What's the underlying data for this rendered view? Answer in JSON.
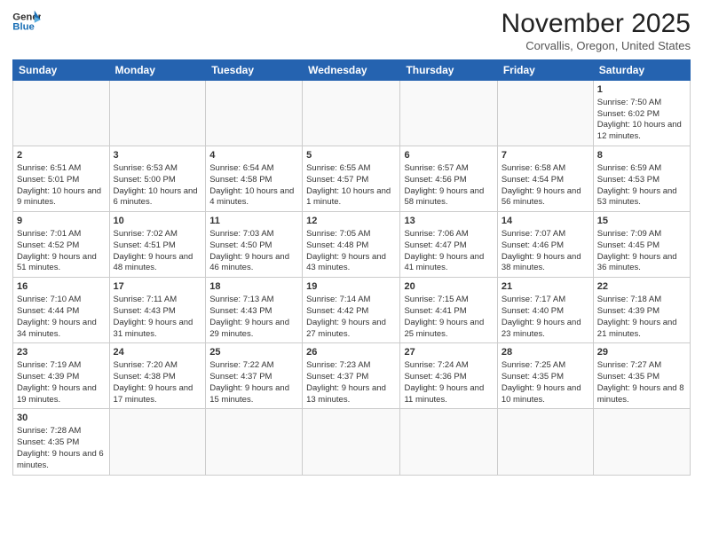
{
  "logo": {
    "line1": "General",
    "line2": "Blue"
  },
  "title": "November 2025",
  "location": "Corvallis, Oregon, United States",
  "days_of_week": [
    "Sunday",
    "Monday",
    "Tuesday",
    "Wednesday",
    "Thursday",
    "Friday",
    "Saturday"
  ],
  "weeks": [
    [
      {
        "day": "",
        "data": ""
      },
      {
        "day": "",
        "data": ""
      },
      {
        "day": "",
        "data": ""
      },
      {
        "day": "",
        "data": ""
      },
      {
        "day": "",
        "data": ""
      },
      {
        "day": "",
        "data": ""
      },
      {
        "day": "1",
        "data": "Sunrise: 7:50 AM\nSunset: 6:02 PM\nDaylight: 10 hours and 12 minutes."
      }
    ],
    [
      {
        "day": "2",
        "data": "Sunrise: 6:51 AM\nSunset: 5:01 PM\nDaylight: 10 hours and 9 minutes."
      },
      {
        "day": "3",
        "data": "Sunrise: 6:53 AM\nSunset: 5:00 PM\nDaylight: 10 hours and 6 minutes."
      },
      {
        "day": "4",
        "data": "Sunrise: 6:54 AM\nSunset: 4:58 PM\nDaylight: 10 hours and 4 minutes."
      },
      {
        "day": "5",
        "data": "Sunrise: 6:55 AM\nSunset: 4:57 PM\nDaylight: 10 hours and 1 minute."
      },
      {
        "day": "6",
        "data": "Sunrise: 6:57 AM\nSunset: 4:56 PM\nDaylight: 9 hours and 58 minutes."
      },
      {
        "day": "7",
        "data": "Sunrise: 6:58 AM\nSunset: 4:54 PM\nDaylight: 9 hours and 56 minutes."
      },
      {
        "day": "8",
        "data": "Sunrise: 6:59 AM\nSunset: 4:53 PM\nDaylight: 9 hours and 53 minutes."
      }
    ],
    [
      {
        "day": "9",
        "data": "Sunrise: 7:01 AM\nSunset: 4:52 PM\nDaylight: 9 hours and 51 minutes."
      },
      {
        "day": "10",
        "data": "Sunrise: 7:02 AM\nSunset: 4:51 PM\nDaylight: 9 hours and 48 minutes."
      },
      {
        "day": "11",
        "data": "Sunrise: 7:03 AM\nSunset: 4:50 PM\nDaylight: 9 hours and 46 minutes."
      },
      {
        "day": "12",
        "data": "Sunrise: 7:05 AM\nSunset: 4:48 PM\nDaylight: 9 hours and 43 minutes."
      },
      {
        "day": "13",
        "data": "Sunrise: 7:06 AM\nSunset: 4:47 PM\nDaylight: 9 hours and 41 minutes."
      },
      {
        "day": "14",
        "data": "Sunrise: 7:07 AM\nSunset: 4:46 PM\nDaylight: 9 hours and 38 minutes."
      },
      {
        "day": "15",
        "data": "Sunrise: 7:09 AM\nSunset: 4:45 PM\nDaylight: 9 hours and 36 minutes."
      }
    ],
    [
      {
        "day": "16",
        "data": "Sunrise: 7:10 AM\nSunset: 4:44 PM\nDaylight: 9 hours and 34 minutes."
      },
      {
        "day": "17",
        "data": "Sunrise: 7:11 AM\nSunset: 4:43 PM\nDaylight: 9 hours and 31 minutes."
      },
      {
        "day": "18",
        "data": "Sunrise: 7:13 AM\nSunset: 4:43 PM\nDaylight: 9 hours and 29 minutes."
      },
      {
        "day": "19",
        "data": "Sunrise: 7:14 AM\nSunset: 4:42 PM\nDaylight: 9 hours and 27 minutes."
      },
      {
        "day": "20",
        "data": "Sunrise: 7:15 AM\nSunset: 4:41 PM\nDaylight: 9 hours and 25 minutes."
      },
      {
        "day": "21",
        "data": "Sunrise: 7:17 AM\nSunset: 4:40 PM\nDaylight: 9 hours and 23 minutes."
      },
      {
        "day": "22",
        "data": "Sunrise: 7:18 AM\nSunset: 4:39 PM\nDaylight: 9 hours and 21 minutes."
      }
    ],
    [
      {
        "day": "23",
        "data": "Sunrise: 7:19 AM\nSunset: 4:39 PM\nDaylight: 9 hours and 19 minutes."
      },
      {
        "day": "24",
        "data": "Sunrise: 7:20 AM\nSunset: 4:38 PM\nDaylight: 9 hours and 17 minutes."
      },
      {
        "day": "25",
        "data": "Sunrise: 7:22 AM\nSunset: 4:37 PM\nDaylight: 9 hours and 15 minutes."
      },
      {
        "day": "26",
        "data": "Sunrise: 7:23 AM\nSunset: 4:37 PM\nDaylight: 9 hours and 13 minutes."
      },
      {
        "day": "27",
        "data": "Sunrise: 7:24 AM\nSunset: 4:36 PM\nDaylight: 9 hours and 11 minutes."
      },
      {
        "day": "28",
        "data": "Sunrise: 7:25 AM\nSunset: 4:35 PM\nDaylight: 9 hours and 10 minutes."
      },
      {
        "day": "29",
        "data": "Sunrise: 7:27 AM\nSunset: 4:35 PM\nDaylight: 9 hours and 8 minutes."
      }
    ],
    [
      {
        "day": "30",
        "data": "Sunrise: 7:28 AM\nSunset: 4:35 PM\nDaylight: 9 hours and 6 minutes."
      },
      {
        "day": "",
        "data": ""
      },
      {
        "day": "",
        "data": ""
      },
      {
        "day": "",
        "data": ""
      },
      {
        "day": "",
        "data": ""
      },
      {
        "day": "",
        "data": ""
      },
      {
        "day": "",
        "data": ""
      }
    ]
  ]
}
